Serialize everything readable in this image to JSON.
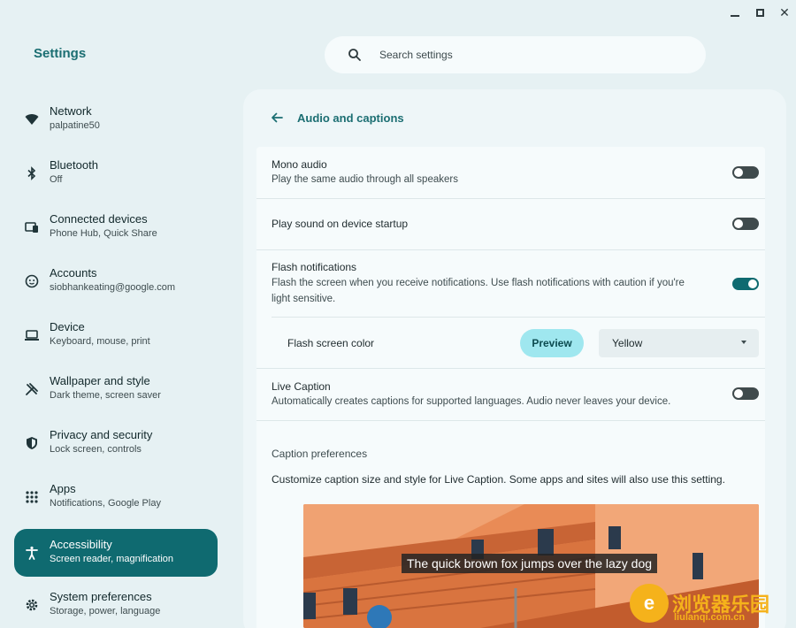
{
  "window": {
    "minimize": "minimize",
    "maximize": "maximize",
    "close": "✕"
  },
  "app_title": "Settings",
  "search": {
    "placeholder": "Search settings"
  },
  "sidebar": {
    "items": [
      {
        "title": "Network",
        "subtitle": "palpatine50",
        "icon": "wifi-icon"
      },
      {
        "title": "Bluetooth",
        "subtitle": "Off",
        "icon": "bluetooth-icon"
      },
      {
        "title": "Connected devices",
        "subtitle": "Phone Hub, Quick Share",
        "icon": "connected-devices-icon"
      },
      {
        "title": "Accounts",
        "subtitle": "siobhankeating@google.com",
        "icon": "account-icon"
      },
      {
        "title": "Device",
        "subtitle": "Keyboard, mouse, print",
        "icon": "laptop-icon"
      },
      {
        "title": "Wallpaper and style",
        "subtitle": "Dark theme, screen saver",
        "icon": "palette-icon"
      },
      {
        "title": "Privacy and security",
        "subtitle": "Lock screen, controls",
        "icon": "shield-icon"
      },
      {
        "title": "Apps",
        "subtitle": "Notifications, Google Play",
        "icon": "apps-grid-icon"
      },
      {
        "title": "Accessibility",
        "subtitle": "Screen reader, magnification",
        "icon": "accessibility-icon",
        "active": true
      },
      {
        "title": "System preferences",
        "subtitle": "Storage, power, language",
        "icon": "gear-icon"
      }
    ]
  },
  "main": {
    "title": "Audio and captions",
    "mono_audio": {
      "title": "Mono audio",
      "subtitle": "Play the same audio through all speakers",
      "on": false
    },
    "startup_sound": {
      "title": "Play sound on device startup",
      "on": false
    },
    "flash": {
      "title": "Flash notifications",
      "subtitle_line1": "Flash the screen when you receive notifications. Use flash notifications with caution if you're",
      "subtitle_line2": "light sensitive.",
      "on": true
    },
    "flash_color": {
      "label": "Flash screen color",
      "preview_label": "Preview",
      "selected": "Yellow"
    },
    "live_caption": {
      "title": "Live Caption",
      "subtitle": "Automatically creates captions for supported languages. Audio never leaves your device.",
      "on": false
    },
    "caption_prefs": {
      "heading": "Caption preferences",
      "description": "Customize caption size and style for Live Caption. Some apps and sites will also use this setting.",
      "sample_caption": "The quick brown fox jumps over the lazy dog"
    }
  },
  "watermark": {
    "text": "浏览器乐园",
    "sub": "liulanqi.com.cn",
    "glyph": "e"
  },
  "colors": {
    "accent": "#0f6a70",
    "background": "#e6f1f3",
    "preview_button": "#9fe7ef"
  }
}
